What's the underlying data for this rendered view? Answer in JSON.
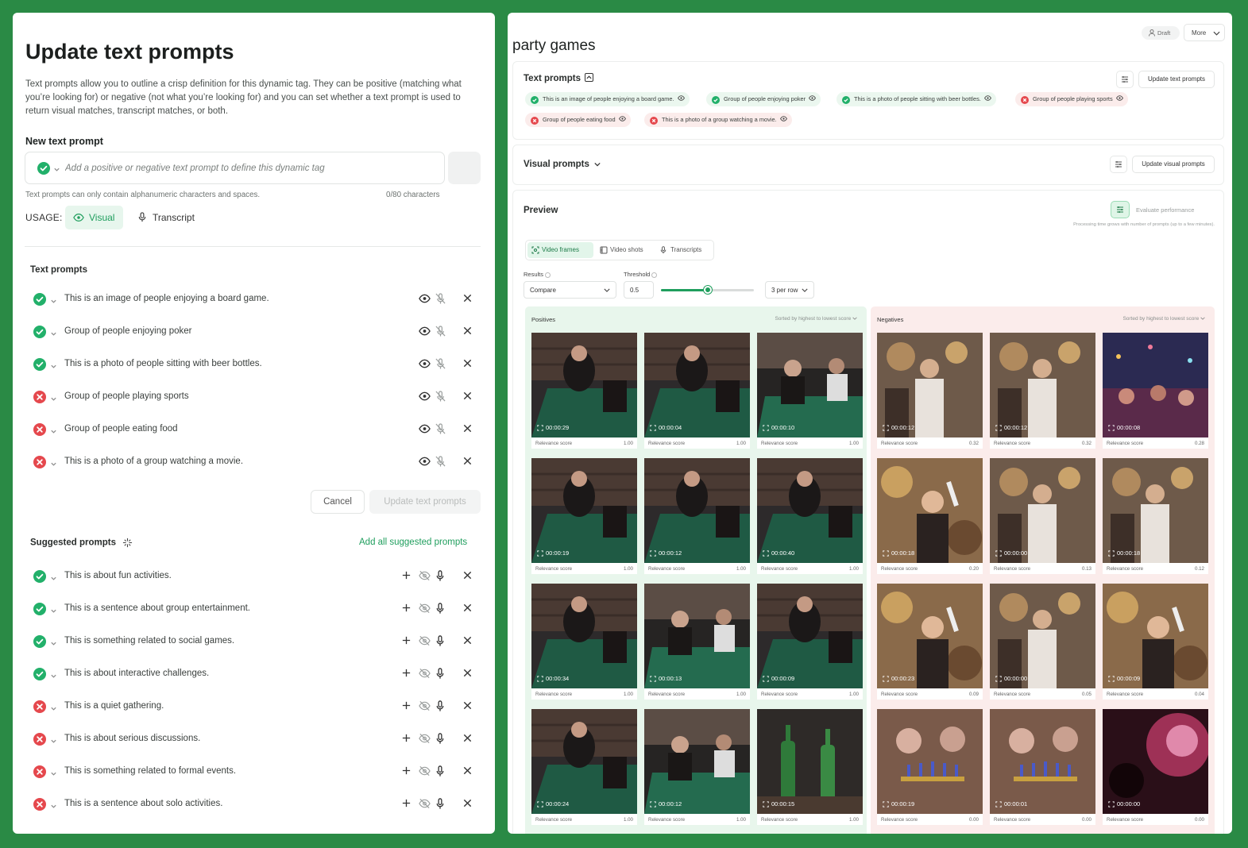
{
  "left": {
    "title": "Update text prompts",
    "description": "Text prompts allow you to outline a crisp definition for this dynamic tag. They can be positive (matching what you’re looking for) or negative (not what you’re looking for) and you can set whether a text prompt is used to return visual matches, transcript matches, or both.",
    "new_prompt_label": "New text prompt",
    "input_placeholder": "Add a positive or negative text prompt to define this dynamic tag",
    "hint": "Text prompts can only contain alphanumeric characters and spaces.",
    "char_count": "0/80 characters",
    "usage_label": "USAGE:",
    "usage_visual": "Visual",
    "usage_transcript": "Transcript",
    "text_prompts_title": "Text prompts",
    "text_prompts": [
      {
        "text": "This is an image of people enjoying a board game.",
        "type": "positive"
      },
      {
        "text": "Group of people enjoying poker",
        "type": "positive"
      },
      {
        "text": "This is a photo of people sitting with beer bottles.",
        "type": "positive"
      },
      {
        "text": "Group of people playing sports",
        "type": "negative"
      },
      {
        "text": "Group of people eating food",
        "type": "negative"
      },
      {
        "text": "This is a photo of a group watching a movie.",
        "type": "negative"
      }
    ],
    "cancel": "Cancel",
    "update": "Update text prompts",
    "suggested_title": "Suggested prompts",
    "add_all": "Add all suggested prompts",
    "suggested": [
      {
        "text": "This is about fun activities.",
        "type": "positive"
      },
      {
        "text": "This is a sentence about group entertainment.",
        "type": "positive"
      },
      {
        "text": "This is something related to social games.",
        "type": "positive"
      },
      {
        "text": "This is about interactive challenges.",
        "type": "positive"
      },
      {
        "text": "This is a quiet gathering.",
        "type": "negative"
      },
      {
        "text": "This is about serious discussions.",
        "type": "negative"
      },
      {
        "text": "This is something related to formal events.",
        "type": "negative"
      },
      {
        "text": "This is a sentence about solo activities.",
        "type": "negative"
      }
    ]
  },
  "right": {
    "title": "party games",
    "draft": "Draft",
    "more": "More",
    "text_prompts_title": "Text prompts",
    "update_text_prompts": "Update text prompts",
    "chips": [
      {
        "text": "This is an image of people enjoying a board game.",
        "type": "positive"
      },
      {
        "text": "Group of people enjoying poker",
        "type": "positive"
      },
      {
        "text": "This is a photo of people sitting with beer bottles.",
        "type": "positive"
      },
      {
        "text": "Group of people playing sports",
        "type": "negative"
      },
      {
        "text": "Group of people eating food",
        "type": "negative"
      },
      {
        "text": "This is a photo of a group watching a movie.",
        "type": "negative"
      }
    ],
    "visual_prompts_title": "Visual prompts",
    "update_visual_prompts": "Update visual prompts",
    "preview_title": "Preview",
    "evaluate": "Evaluate performance",
    "processing_note": "Processing time grows with number of prompts (up to a few minutes).",
    "tabs": [
      "Video frames",
      "Video shots",
      "Transcripts"
    ],
    "results_label": "Results",
    "results_value": "Compare",
    "threshold_label": "Threshold",
    "threshold_value": "0.5",
    "threshold_fraction": 0.5,
    "per_row": "3 per row",
    "positives_label": "Positives",
    "negatives_label": "Negatives",
    "sort_label": "Sorted by highest to lowest score",
    "relevance_label": "Relevance score",
    "positives": [
      {
        "time": "00:00:29",
        "score": "1.00"
      },
      {
        "time": "00:00:04",
        "score": "1.00"
      },
      {
        "time": "00:00:10",
        "score": "1.00"
      },
      {
        "time": "00:00:19",
        "score": "1.00"
      },
      {
        "time": "00:00:12",
        "score": "1.00"
      },
      {
        "time": "00:00:40",
        "score": "1.00"
      },
      {
        "time": "00:00:34",
        "score": "1.00"
      },
      {
        "time": "00:00:13",
        "score": "1.00"
      },
      {
        "time": "00:00:09",
        "score": "1.00"
      },
      {
        "time": "00:00:24",
        "score": "1.00"
      },
      {
        "time": "00:00:12",
        "score": "1.00"
      },
      {
        "time": "00:00:15",
        "score": "1.00"
      }
    ],
    "negatives": [
      {
        "time": "00:00:12",
        "score": "0.32"
      },
      {
        "time": "00:00:12",
        "score": "0.32"
      },
      {
        "time": "00:00:08",
        "score": "0.28"
      },
      {
        "time": "00:00:18",
        "score": "0.20"
      },
      {
        "time": "00:00:00",
        "score": "0.13"
      },
      {
        "time": "00:00:18",
        "score": "0.12"
      },
      {
        "time": "00:00:23",
        "score": "0.09"
      },
      {
        "time": "00:00:00",
        "score": "0.05"
      },
      {
        "time": "00:00:09",
        "score": "0.04"
      },
      {
        "time": "00:00:19",
        "score": "0.00"
      },
      {
        "time": "00:00:01",
        "score": "0.00"
      },
      {
        "time": "00:00:00",
        "score": "0.00"
      }
    ]
  },
  "colors": {
    "accent": "#1f9e5d",
    "negative": "#e5484d",
    "background": "#2a8a45"
  }
}
